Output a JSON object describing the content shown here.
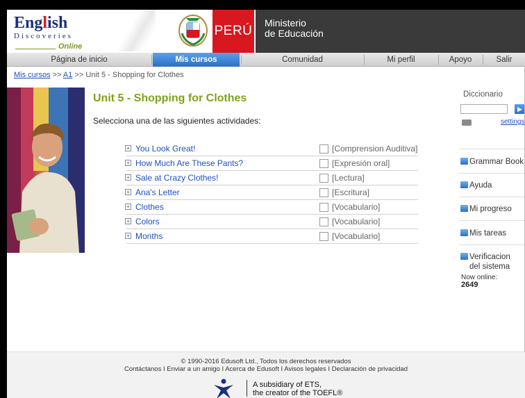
{
  "header": {
    "logo_word": "Eng",
    "logo_g": "l",
    "logo_rest": "ish",
    "logo_sub": "Discoveries",
    "logo_online": "Online",
    "country": "PERÚ",
    "ministry_line1": "Ministerio",
    "ministry_line2": "de Educación"
  },
  "nav": {
    "items": [
      {
        "label": "Página de inicio"
      },
      {
        "label": "Mis cursos"
      },
      {
        "label": "Comunidad"
      },
      {
        "label": "Mi perfil"
      },
      {
        "label": "Apoyo"
      },
      {
        "label": "Salir"
      }
    ],
    "active_index": 1
  },
  "breadcrumb": {
    "link1": "Mis cursos",
    "sep1": " >> ",
    "link2": "A1",
    "sep2": " >> ",
    "current": "Unit 5 - Shopping for Clothes"
  },
  "main": {
    "title": "Unit 5 - Shopping for Clothes",
    "instruction": "Selecciona una de las siguientes actividades:",
    "activities": [
      {
        "name": "You Look Great!",
        "category": "[Comprension Auditiva]",
        "expand": "+"
      },
      {
        "name": "How Much Are These Pants?",
        "category": "[Expresión oral]",
        "expand": "+"
      },
      {
        "name": "Sale at Crazy Clothes!",
        "category": "[Lectura]",
        "expand": "+"
      },
      {
        "name": "Ana's Letter",
        "category": "[Escritura]",
        "expand": "+"
      },
      {
        "name": "Clothes",
        "category": "[Vocabulario]",
        "expand": "+"
      },
      {
        "name": "Colors",
        "category": "[Vocabulario]",
        "expand": "+"
      },
      {
        "name": "Months",
        "category": "[Vocabulario]",
        "expand": "+"
      }
    ]
  },
  "sidebar": {
    "dictionary_label": "Diccionario",
    "dictionary_value": "",
    "go_glyph": "▶",
    "settings_label": "settings",
    "grammar_book": "Grammar Book",
    "help": "Ayuda",
    "progress": "Mi progreso",
    "tasks": "Mis tareas",
    "system_check_1": "Verificacion",
    "system_check_2": "del sistema",
    "online_label": "Now online:",
    "online_count": "2649"
  },
  "footer": {
    "copyright": "© 1990-2016 Edusoft Ltd., Todos los derechos reservados",
    "links": "Contáctanos I  Enviar a un amigo I  Acerca de Edusoft  I  Avisos legales I   Declaración de privacidad",
    "ets_line1": "A subsidiary of ETS,",
    "ets_line2": "the creator of the TOEFL®"
  },
  "colors": {
    "accent_green": "#7ea21d",
    "link_blue": "#1f4fbf",
    "peru_red": "#d8171f",
    "ministry_gray": "#3a3a3a",
    "nav_active": "#2d6fc4"
  }
}
